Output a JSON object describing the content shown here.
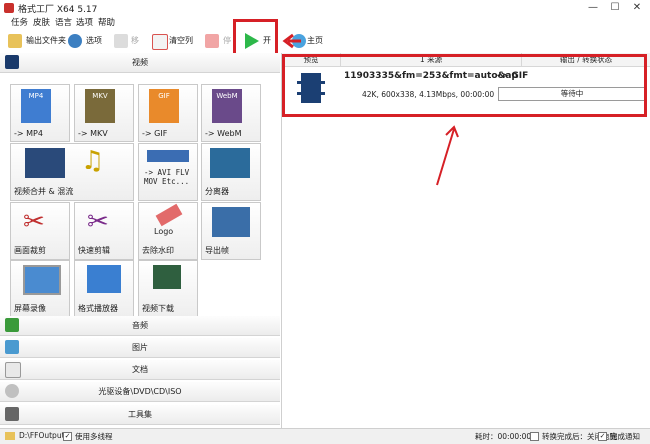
{
  "window": {
    "title": "格式工厂 X64 5.17",
    "minimize": "—",
    "maximize": "☐",
    "close": "✕"
  },
  "menu": [
    "任务",
    "皮肤",
    "语言",
    "选项",
    "帮助"
  ],
  "toolbar": {
    "output_folder": "输出文件夹",
    "options": "选项",
    "remove": "移除",
    "clear_list": "清空列表",
    "stop": "停",
    "start": "开始",
    "home": "主页"
  },
  "categories": {
    "video": "视频",
    "audio": "音频",
    "image": "图片",
    "document": "文档",
    "optical": "光驱设备\\DVD\\CD\\ISO",
    "toolbox": "工具集"
  },
  "video_tiles": [
    {
      "label": "-> MP4",
      "art": "MP4"
    },
    {
      "label": "-> MKV",
      "art": "MKV"
    },
    {
      "label": "-> GIF",
      "art": "GIF"
    },
    {
      "label": "-> WebM",
      "art": "WebM"
    },
    {
      "label": "视频合并 & 混流",
      "art": ""
    },
    {
      "label": "-> AVI FLV\nMOV Etc...",
      "art": ""
    },
    {
      "label": "分离器",
      "art": ""
    },
    {
      "label": "画面裁剪",
      "art": ""
    },
    {
      "label": "快速剪辑",
      "art": ""
    },
    {
      "label": "去除水印",
      "art": "Logo"
    },
    {
      "label": "导出帧",
      "art": ""
    },
    {
      "label": "屏幕录像",
      "art": ""
    },
    {
      "label": "格式播放器",
      "art": ""
    },
    {
      "label": "视频下载",
      "art": ""
    }
  ],
  "task_list": {
    "columns": [
      "预览",
      "1 来源",
      "输出 / 转换状态"
    ],
    "tasks": [
      {
        "name": "11903335&fm=253&fmt=auto&ap",
        "target": "-> GIF",
        "info": "42K, 600x338, 4.13Mbps, 00:00:00",
        "status": "等待中"
      }
    ]
  },
  "statusbar": {
    "output_path": "D:\\FFOutput",
    "multithread": "使用多线程",
    "elapsed": "耗时：00:00:00",
    "after_convert": "转换完成后：关闭电脑",
    "notify": "完成通知"
  },
  "colors": {
    "highlight": "#d62026",
    "start_green": "#2db84a"
  }
}
